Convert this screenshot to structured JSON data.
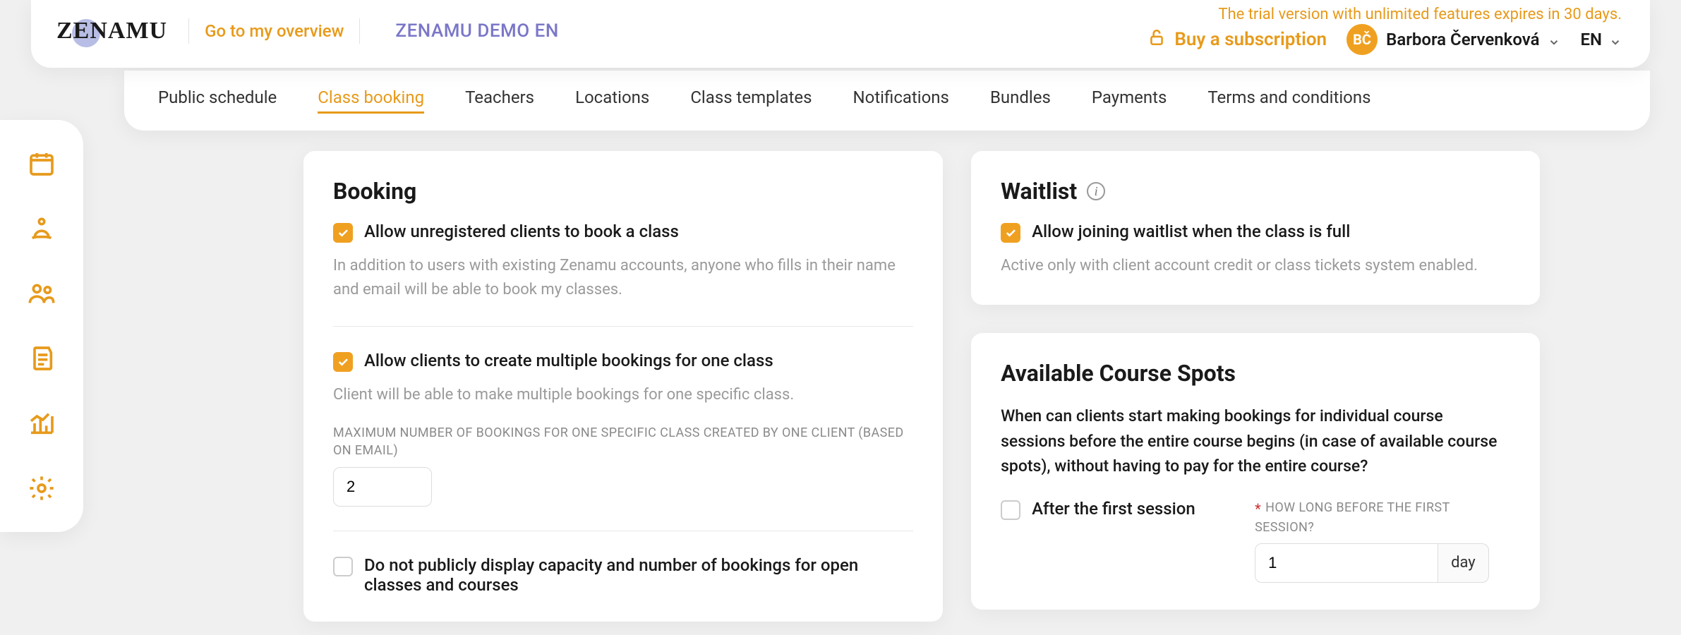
{
  "topbar": {
    "logo_text": "ZENAMU",
    "overview_link": "Go to my overview",
    "demo_title": "ZENAMU DEMO EN",
    "trial_notice": "The trial version with unlimited features expires in 30 days.",
    "buy_label": "Buy a subscription",
    "avatar_initials": "BČ",
    "username": "Barbora Červenková",
    "language": "EN"
  },
  "tabs": [
    {
      "label": "Public schedule",
      "active": false
    },
    {
      "label": "Class booking",
      "active": true
    },
    {
      "label": "Teachers",
      "active": false
    },
    {
      "label": "Locations",
      "active": false
    },
    {
      "label": "Class templates",
      "active": false
    },
    {
      "label": "Notifications",
      "active": false
    },
    {
      "label": "Bundles",
      "active": false
    },
    {
      "label": "Payments",
      "active": false
    },
    {
      "label": "Terms and conditions",
      "active": false
    }
  ],
  "sidebar_icons": [
    "calendar-icon",
    "meditate-icon",
    "people-icon",
    "report-icon",
    "analytics-icon",
    "settings-icon"
  ],
  "booking": {
    "title": "Booking",
    "allow_unregistered_label": "Allow unregistered clients to book a class",
    "allow_unregistered_help": "In addition to users with existing Zenamu accounts, anyone who fills in their name and email will be able to book my classes.",
    "allow_multiple_label": "Allow clients to create multiple bookings for one class",
    "allow_multiple_help": "Client will be able to make multiple bookings for one specific class.",
    "max_bookings_label": "MAXIMUM NUMBER OF BOOKINGS FOR ONE SPECIFIC CLASS CREATED BY ONE CLIENT (BASED ON EMAIL)",
    "max_bookings_value": "2",
    "hide_capacity_label": "Do not publicly display capacity and number of bookings for open classes and courses"
  },
  "waitlist": {
    "title": "Waitlist",
    "allow_label": "Allow joining waitlist when the class is full",
    "help": "Active only with client account credit or class tickets system enabled."
  },
  "course_spots": {
    "title": "Available Course Spots",
    "description": "When can clients start making bookings for individual course sessions before the entire course begins (in case of available course spots), without having to pay for the entire course?",
    "after_first_label": "After the first session",
    "how_long_label": "HOW LONG BEFORE THE FIRST SESSION?",
    "how_long_value": "1",
    "how_long_unit": "day"
  }
}
